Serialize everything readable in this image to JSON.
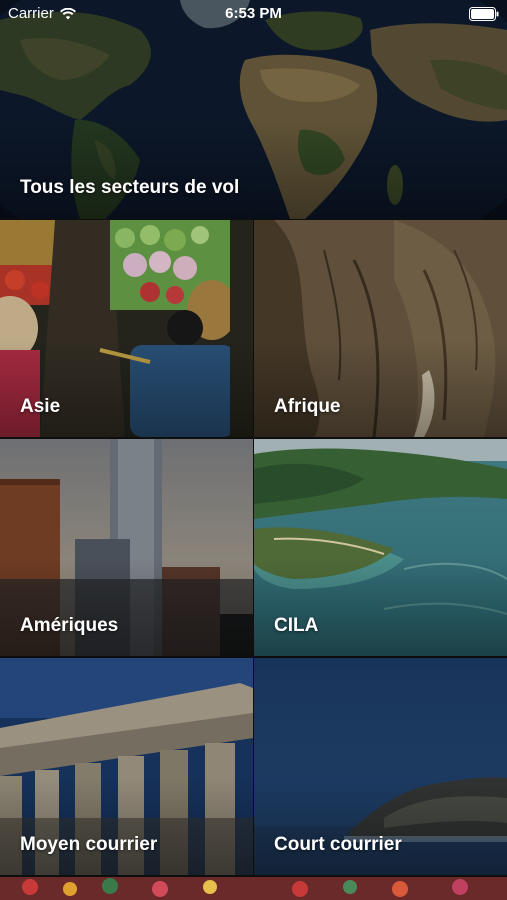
{
  "status_bar": {
    "carrier": "Carrier",
    "time": "6:53 PM",
    "icons": [
      "wifi-icon",
      "battery-icon"
    ]
  },
  "hero": {
    "label": "Tous les secteurs de vol",
    "image": "world-map-satellite"
  },
  "tiles": [
    {
      "label": "Asie",
      "image": "floating-market"
    },
    {
      "label": "Afrique",
      "image": "elephant-skin"
    },
    {
      "label": "Amériques",
      "image": "city-skyline"
    },
    {
      "label": "CILA",
      "image": "lagoon-island"
    },
    {
      "label": "Moyen courrier",
      "image": "greek-ruins"
    },
    {
      "label": "Court courrier",
      "image": "sea-coast"
    }
  ]
}
